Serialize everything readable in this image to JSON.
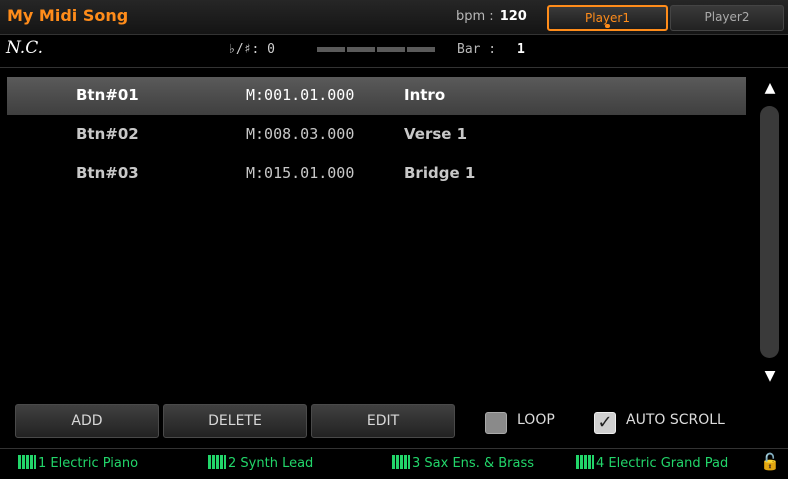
{
  "header": {
    "song_title": "My Midi Song",
    "bpm_label": "bpm :",
    "bpm_value": "120",
    "player1_label": "Player1",
    "player2_label": "Player2"
  },
  "info": {
    "chord": "N.C.",
    "transpose_label": "♭/♯:",
    "transpose_value": "0",
    "bar_label": "Bar :",
    "bar_value": "1"
  },
  "list": {
    "rows": [
      {
        "button": "Btn#01",
        "position": "M:001.01.000",
        "name": "Intro",
        "selected": true
      },
      {
        "button": "Btn#02",
        "position": "M:008.03.000",
        "name": "Verse 1",
        "selected": false
      },
      {
        "button": "Btn#03",
        "position": "M:015.01.000",
        "name": "Bridge 1",
        "selected": false
      }
    ]
  },
  "scroll": {
    "up_icon": "▲",
    "down_icon": "▼"
  },
  "buttons": {
    "add": "ADD",
    "delete": "DELETE",
    "edit": "EDIT"
  },
  "checkboxes": {
    "loop": {
      "label": "LOOP",
      "checked": false
    },
    "auto_scroll": {
      "label": "AUTO SCROLL",
      "checked": true,
      "check_glyph": "✓"
    }
  },
  "tracks": [
    {
      "number": "1",
      "name": "Electric Piano"
    },
    {
      "number": "2",
      "name": "Synth Lead"
    },
    {
      "number": "3",
      "name": "Sax Ens. & Brass"
    },
    {
      "number": "4",
      "name": "Electric Grand Pad"
    }
  ],
  "lock_icon": "🔓",
  "colors": {
    "accent": "#ff8c1a",
    "track_green": "#22d66a",
    "selected_row": "#4a4a4a"
  }
}
